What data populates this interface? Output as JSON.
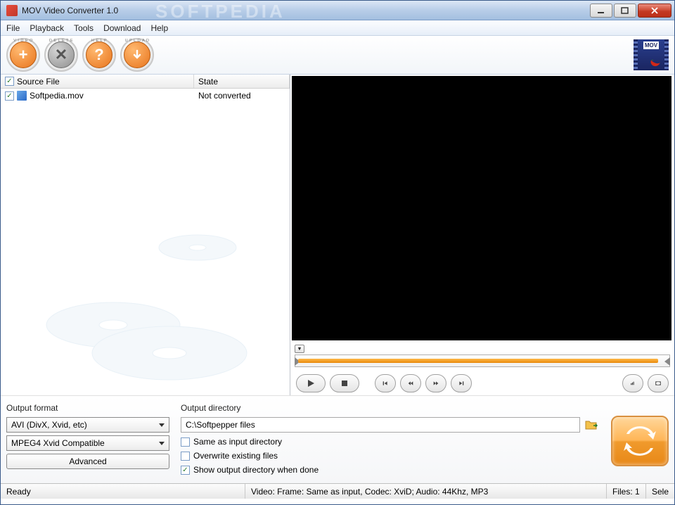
{
  "window": {
    "title": "MOV Video Converter 1.0",
    "bg_text": "SOFTPEDIA"
  },
  "menu": {
    "file": "File",
    "playback": "Playback",
    "tools": "Tools",
    "download": "Download",
    "help": "Help"
  },
  "toolbar": {
    "video": "V I D E O",
    "delete": "D E L E T E",
    "help": "H E L P",
    "upload": "U P L O A D",
    "mov": "MOV"
  },
  "table": {
    "col_source": "Source File",
    "col_state": "State",
    "rows": [
      {
        "name": "Softpedia.mov",
        "state": "Not converted"
      }
    ]
  },
  "output_format": {
    "label": "Output format",
    "container": "AVI (DivX, Xvid, etc)",
    "codec": "MPEG4 Xvid Compatible",
    "advanced": "Advanced"
  },
  "output_dir": {
    "label": "Output directory",
    "path": "C:\\Softpepper files",
    "same_as_input": "Same as input directory",
    "overwrite": "Overwrite existing files",
    "show_when_done": "Show output directory when done"
  },
  "status": {
    "ready": "Ready",
    "video_info": "Video: Frame: Same as input, Codec: XviD; Audio: 44Khz, MP3",
    "files": "Files: 1",
    "sele": "Sele"
  }
}
